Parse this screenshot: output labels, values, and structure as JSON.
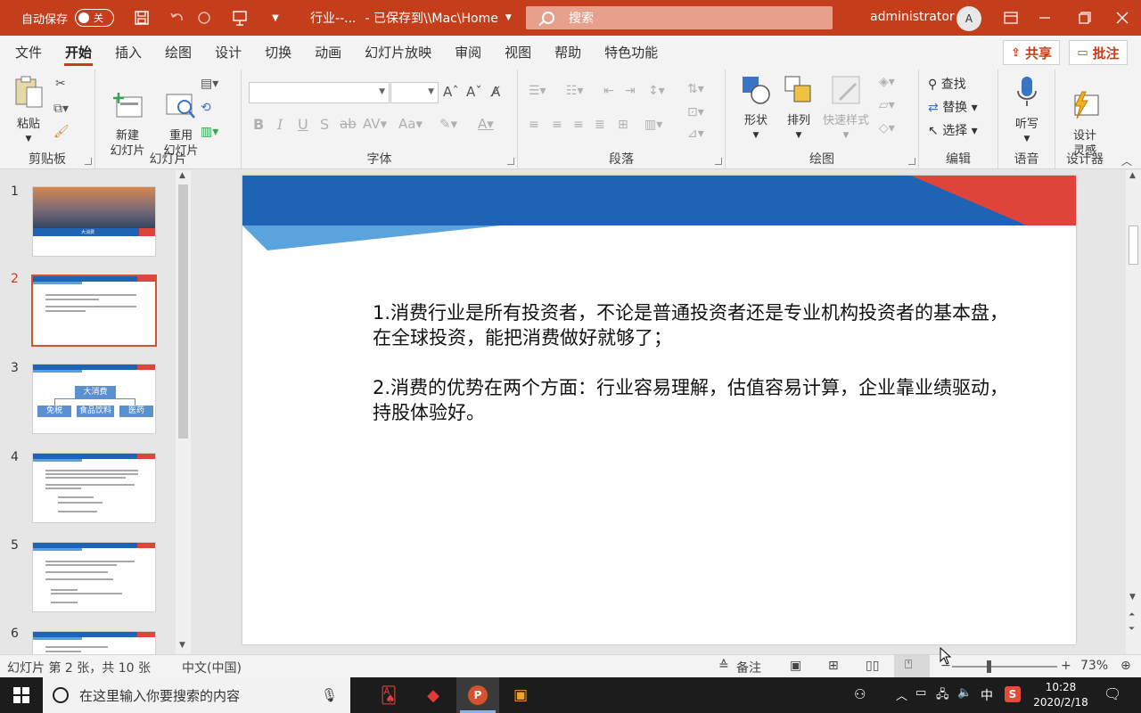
{
  "titlebar": {
    "autosave_label": "自动保存",
    "autosave_state": "关",
    "doc_name": "行业--...",
    "saved_status": "- 已保存到\\\\Mac\\Home",
    "search_placeholder": "搜索",
    "user": "administrator",
    "avatar_initial": "A"
  },
  "tabs": [
    "文件",
    "开始",
    "插入",
    "绘图",
    "设计",
    "切换",
    "动画",
    "幻灯片放映",
    "审阅",
    "视图",
    "帮助",
    "特色功能"
  ],
  "active_tab": "开始",
  "share_label": "共享",
  "comments_label": "批注",
  "ribbon": {
    "clipboard": {
      "paste": "粘贴",
      "label": "剪贴板"
    },
    "slides": {
      "new_slide": "新建\n幻灯片",
      "reuse": "重用\n幻灯片",
      "label": "幻灯片"
    },
    "font": {
      "label": "字体"
    },
    "paragraph": {
      "label": "段落"
    },
    "drawing": {
      "shapes": "形状",
      "arrange": "排列",
      "quick_styles": "快速样式",
      "label": "绘图"
    },
    "editing": {
      "find": "查找",
      "replace": "替换",
      "select": "选择",
      "label": "编辑"
    },
    "voice": {
      "dictate": "听写",
      "label": "语音"
    },
    "designer": {
      "design_ideas": "设计\n灵感",
      "label": "设计器"
    }
  },
  "thumbnails": [
    {
      "num": "1",
      "title": "大消费"
    },
    {
      "num": "2"
    },
    {
      "num": "3",
      "title": "大消费",
      "items": [
        "免税",
        "食品饮料",
        "医药"
      ]
    },
    {
      "num": "4"
    },
    {
      "num": "5"
    },
    {
      "num": "6"
    }
  ],
  "selected_slide": "2",
  "slide": {
    "para1": "1.消费行业是所有投资者，不论是普通投资者还是专业机构投资者的基本盘，在全球投资，能把消费做好就够了；",
    "para2": "2.消费的优势在两个方面：行业容易理解，估值容易计算，企业靠业绩驱动，持股体验好。"
  },
  "status": {
    "slide_count": "幻灯片 第 2 张，共 10 张",
    "language": "中文(中国)",
    "notes": "备注",
    "zoom": "73%",
    "zoom_level_pct": 73
  },
  "taskbar": {
    "search_placeholder": "在这里输入你要搜索的内容",
    "ime": "中",
    "time": "10:28",
    "date": "2020/2/18"
  },
  "colors": {
    "brand": "#c43e1c",
    "slide_blue": "#1e63b4",
    "slide_red": "#e0433a"
  }
}
